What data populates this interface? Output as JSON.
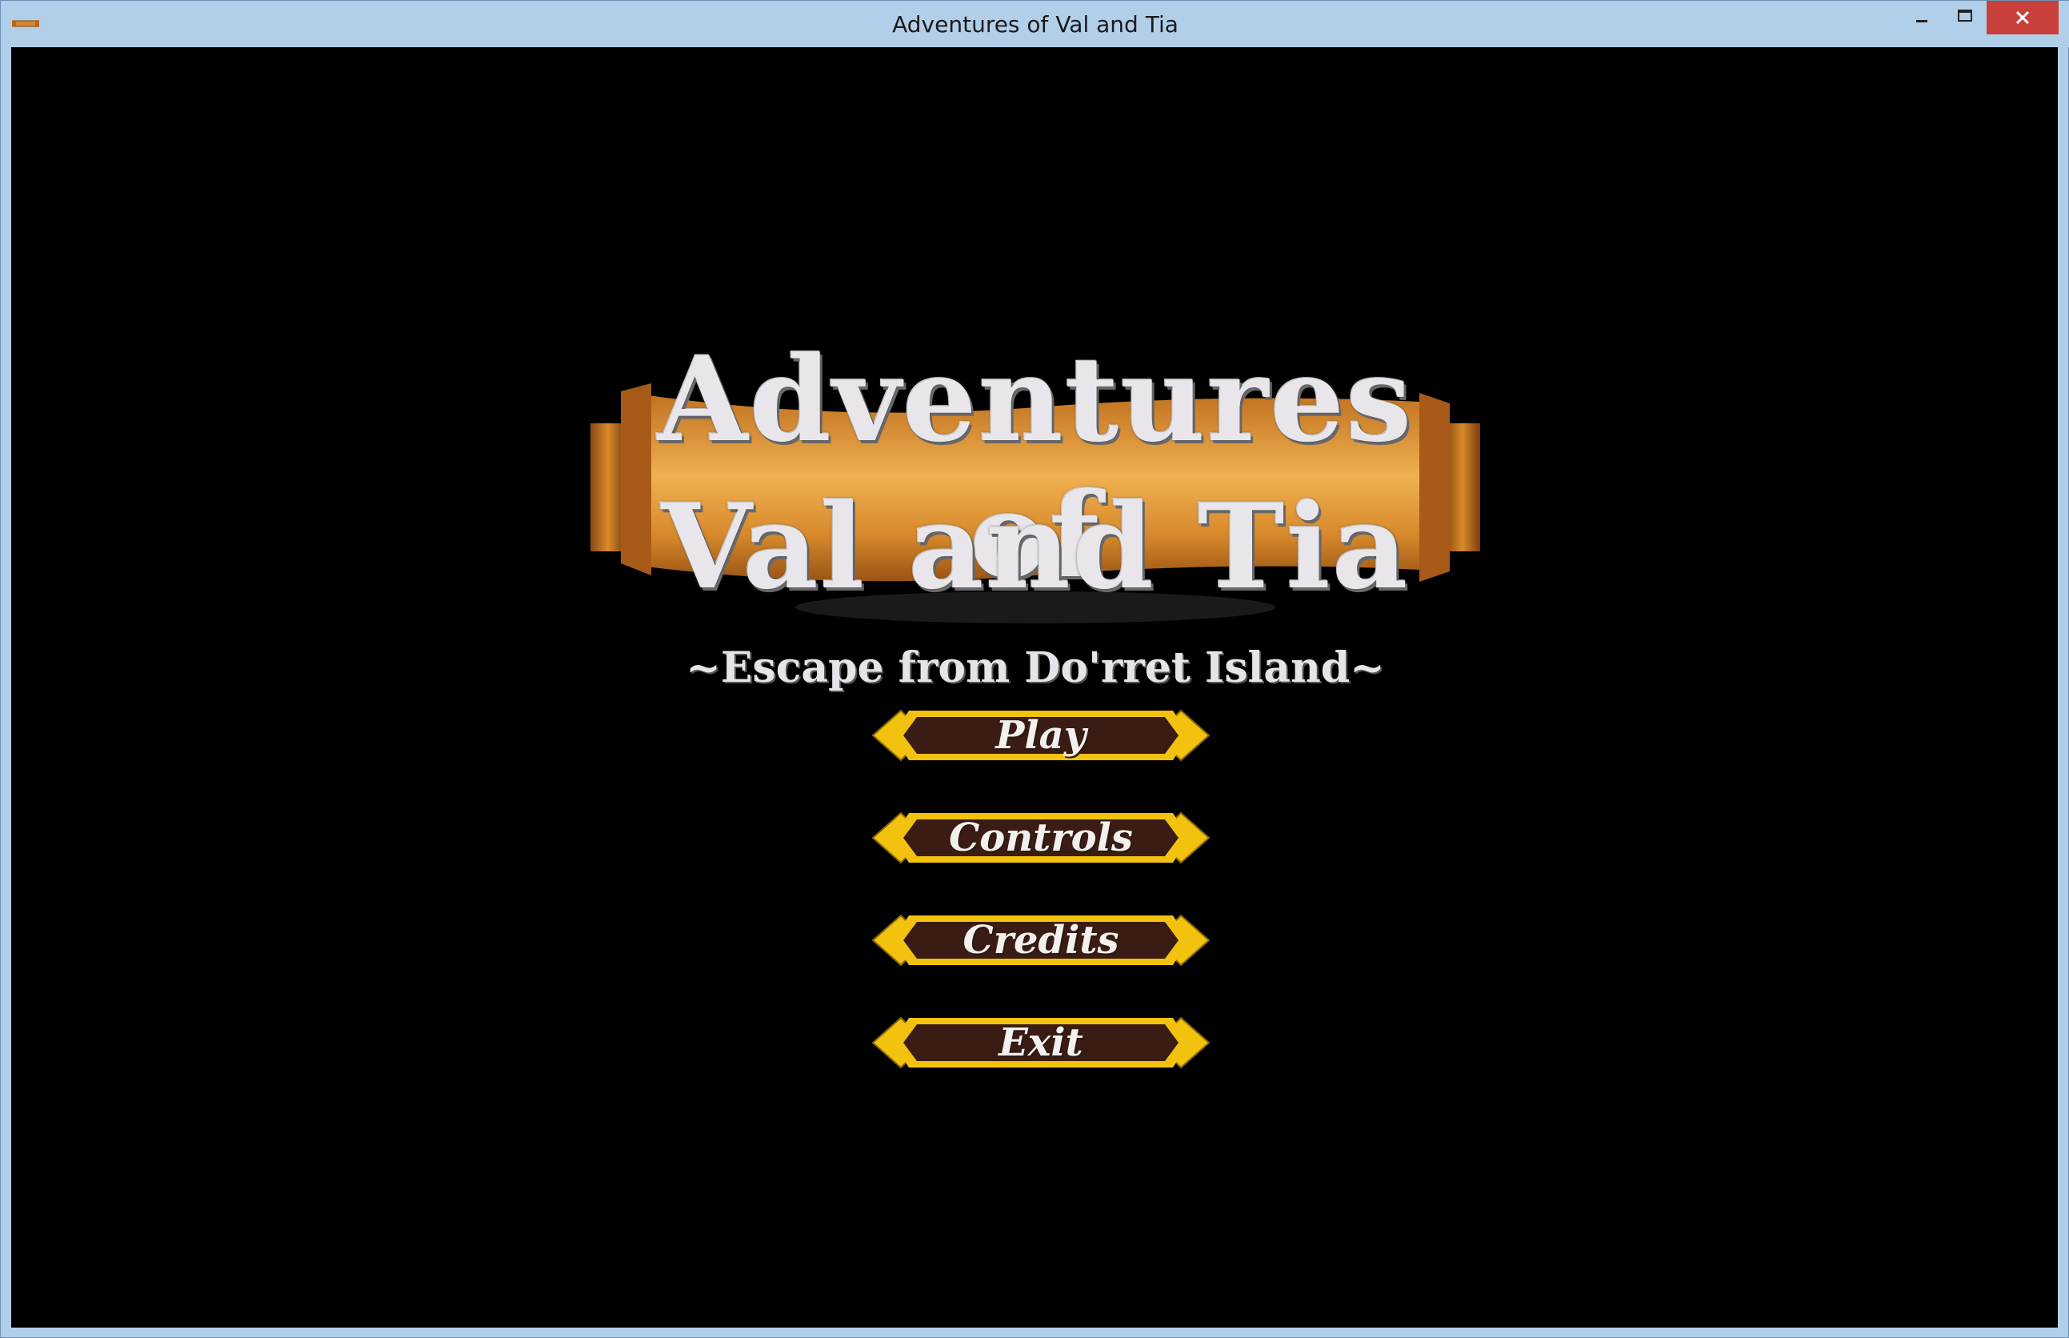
{
  "window": {
    "title": "Adventures of Val and Tia",
    "icon": "scroll-icon",
    "controls": {
      "minimize": "minimize-icon",
      "maximize": "maximize-icon",
      "close": "close-icon"
    },
    "close_color": "#c9403a"
  },
  "game": {
    "logo": {
      "line1": "Adventures of",
      "line2": "Val and Tia",
      "subtitle": "~Escape from Do'rret Island~"
    },
    "menu": [
      {
        "label": "Play"
      },
      {
        "label": "Controls"
      },
      {
        "label": "Credits"
      },
      {
        "label": "Exit"
      }
    ],
    "colors": {
      "background": "#000000",
      "button_frame": "#f2c20f",
      "button_fill": "#3a1c14",
      "scroll": "#d98a2b"
    }
  }
}
